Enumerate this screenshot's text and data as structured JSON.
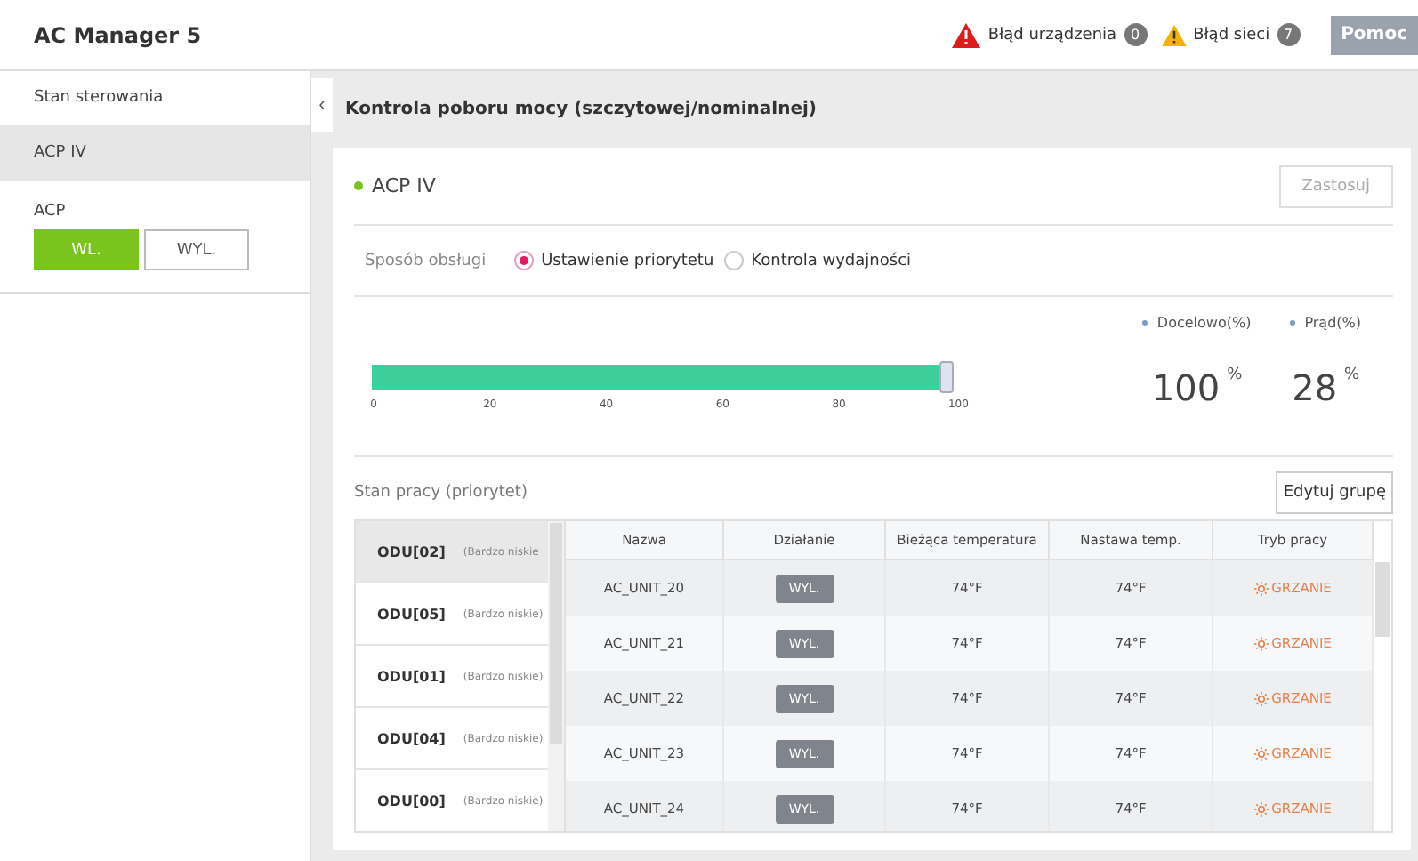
{
  "header": {
    "title": "AC Manager 5",
    "alerts": [
      {
        "kind": "device",
        "label": "Błąd urządzenia",
        "count": "0"
      },
      {
        "kind": "network",
        "label": "Błąd sieci",
        "count": "7"
      }
    ],
    "help": "Pomoc"
  },
  "sidebar": {
    "items": [
      {
        "label": "Stan sterowania",
        "selected": false
      },
      {
        "label": "ACP IV",
        "selected": true
      }
    ],
    "acp": {
      "label": "ACP",
      "buttons": [
        {
          "label": "WL.",
          "selected": true
        },
        {
          "label": "WYL.",
          "selected": false
        }
      ]
    }
  },
  "collapse": "‹",
  "page_title": "Kontrola poboru mocy (szczytowej/nominalnej)",
  "panel": {
    "name": "ACP IV",
    "apply": "Zastosuj",
    "mode_label": "Sposób obsługi",
    "modes": [
      {
        "label": "Ustawienie priorytetu",
        "selected": true
      },
      {
        "label": "Kontrola wydajności",
        "selected": false
      }
    ],
    "slider": {
      "level": 1,
      "ticks": [
        "0",
        "20",
        "40",
        "60",
        "80",
        "100"
      ]
    },
    "readouts": [
      {
        "label": "Docelowo(%)",
        "value": "100",
        "unit": "%"
      },
      {
        "label": "Prąd(%)",
        "value": "28",
        "unit": "%"
      }
    ],
    "status_title": "Stan pracy (priorytet)",
    "edit": "Edytuj grupę",
    "groups": [
      {
        "name": "ODU[02]",
        "priority": "(Bardzo niskie",
        "selected": true
      },
      {
        "name": "ODU[05]",
        "priority": "(Bardzo niskie)",
        "selected": false
      },
      {
        "name": "ODU[01]",
        "priority": "(Bardzo niskie)",
        "selected": false
      },
      {
        "name": "ODU[04]",
        "priority": "(Bardzo niskie)",
        "selected": false
      },
      {
        "name": "ODU[00]",
        "priority": "(Bardzo niskie)",
        "selected": false
      }
    ],
    "table": {
      "columns": [
        "Nazwa",
        "Działanie",
        "Bieżąca temperatura",
        "Nastawa temp.",
        "Tryb pracy"
      ],
      "rows": [
        {
          "name": "AC_UNIT_20",
          "action": "WYL.",
          "current": "74°F",
          "set": "74°F",
          "mode": "GRZANIE"
        },
        {
          "name": "AC_UNIT_21",
          "action": "WYL.",
          "current": "74°F",
          "set": "74°F",
          "mode": "GRZANIE"
        },
        {
          "name": "AC_UNIT_22",
          "action": "WYL.",
          "current": "74°F",
          "set": "74°F",
          "mode": "GRZANIE"
        },
        {
          "name": "AC_UNIT_23",
          "action": "WYL.",
          "current": "74°F",
          "set": "74°F",
          "mode": "GRZANIE"
        },
        {
          "name": "AC_UNIT_24",
          "action": "WYL.",
          "current": "74°F",
          "set": "74°F",
          "mode": "GRZANIE"
        }
      ]
    }
  }
}
